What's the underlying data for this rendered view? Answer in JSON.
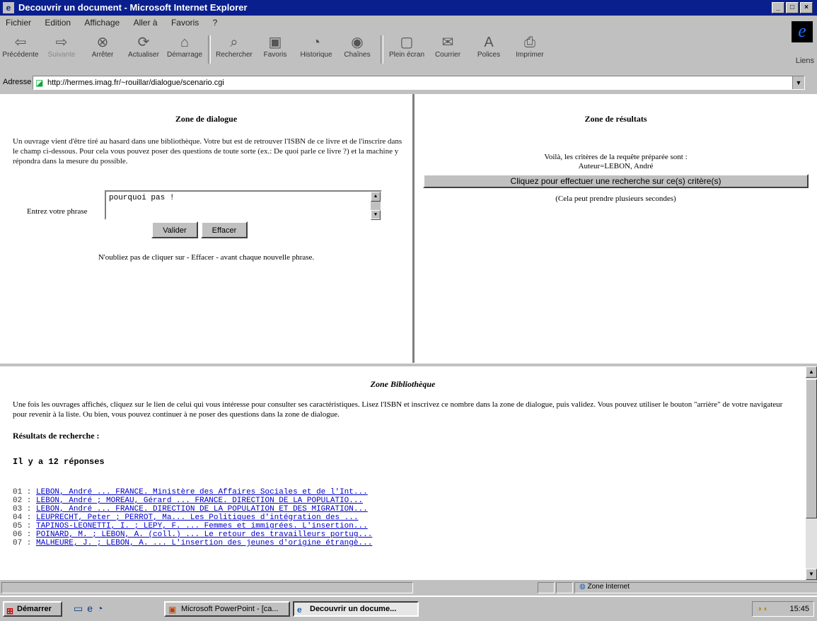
{
  "window": {
    "title": "Decouvrir un document - Microsoft Internet Explorer",
    "controls": [
      "_",
      "□",
      "×"
    ]
  },
  "menu": [
    "Fichier",
    "Edition",
    "Affichage",
    "Aller à",
    "Favoris",
    "?"
  ],
  "toolbar": [
    {
      "label": "Précédente",
      "icon": "back-arrow-icon",
      "glyph": "⇦"
    },
    {
      "label": "Suivante",
      "icon": "forward-arrow-icon",
      "glyph": "⇨"
    },
    {
      "label": "Arrêter",
      "icon": "stop-icon",
      "glyph": "⊗"
    },
    {
      "label": "Actualiser",
      "icon": "refresh-icon",
      "glyph": "⟳"
    },
    {
      "label": "Démarrage",
      "icon": "home-icon",
      "glyph": "⌂"
    },
    {
      "label": "Rechercher",
      "icon": "search-icon",
      "glyph": "⌕"
    },
    {
      "label": "Favoris",
      "icon": "favorites-icon",
      "glyph": "▣"
    },
    {
      "label": "Historique",
      "icon": "history-icon",
      "glyph": "◔"
    },
    {
      "label": "Chaînes",
      "icon": "channels-icon",
      "glyph": "◉"
    },
    {
      "label": "Plein écran",
      "icon": "fullscreen-icon",
      "glyph": "▢"
    },
    {
      "label": "Courrier",
      "icon": "mail-icon",
      "glyph": "✉"
    },
    {
      "label": "Polices",
      "icon": "fonts-icon",
      "glyph": "A"
    },
    {
      "label": "Imprimer",
      "icon": "print-icon",
      "glyph": "⎙"
    }
  ],
  "liens_label": "Liens",
  "address": {
    "label": "Adresse",
    "url": "http://hermes.imag.fr/~rouillar/dialogue/scenario.cgi"
  },
  "dialog_zone": {
    "title": "Zone de dialogue",
    "intro": "Un ouvrage vient d'être tiré au hasard dans une bibliothèque. Votre but est de retrouver l'ISBN de ce livre et de l'inscrire dans le champ ci-dessous. Pour cela vous pouvez poser des questions de toute sorte (ex.: De quoi parle ce livre ?) et la machine y répondra dans la mesure du possible.",
    "phrase_label": "Entrez votre phrase",
    "phrase_value": "pourquoi pas !",
    "validate_label": "Valider",
    "clear_label": "Effacer",
    "note": "N'oubliez pas de cliquer sur - Effacer - avant chaque nouvelle phrase."
  },
  "result_zone": {
    "title": "Zone de résultats",
    "line1": "Voilà, les critères de la requête préparée sont :",
    "line2": "Auteur=LEBON, André",
    "search_button": "Cliquez pour effectuer une recherche sur ce(s) critère(s)",
    "note": "(Cela peut prendre plusieurs secondes)"
  },
  "library_zone": {
    "title": "Zone Bibliothèque",
    "intro": "Une fois les ouvrages affichés, cliquez sur le lien de celui qui vous intéresse pour consulter ses caractéristiques. Lisez l'ISBN et inscrivez ce nombre dans la zone de dialogue, puis validez. Vous pouvez utiliser le bouton \"arrière\" de votre navigateur pour revenir à la liste. Ou bien, vous pouvez continuer à ne poser des questions dans la zone de dialogue.",
    "results_heading": "Résultats de recherche :",
    "count": "Il y a 12 réponses",
    "results": [
      {
        "num": "01 :",
        "text": "LEBON, André ... FRANCE. Ministère des Affaires Sociales et de l'Int..."
      },
      {
        "num": "02 :",
        "text": "LEBON, André ; MOREAU, Gérard ... FRANCE. DIRECTION DE LA POPULATIO..."
      },
      {
        "num": "03 :",
        "text": "LEBON, André ... FRANCE. DIRECTION DE LA POPULATION ET DES MIGRATION..."
      },
      {
        "num": "04 :",
        "text": "LEUPRECHT, Peter ; PERROT, Ma... Les Politiques d'intégration des ..."
      },
      {
        "num": "05 :",
        "text": "TAPINOS-LEONETTI, I. ; LEPY, F. ... Femmes et immigrées. L'insertion..."
      },
      {
        "num": "06 :",
        "text": "POINARD, M. ; LEBON, A. (coll.) ... Le retour des travailleurs portug..."
      },
      {
        "num": "07 :",
        "text": "MALHEURE, J. ; LEBON, A. ... L'insertion des jeunes d'origine étrangè..."
      }
    ]
  },
  "statusbar": {
    "zone": "Zone Internet"
  },
  "taskbar": {
    "start": "Démarrer",
    "tasks": [
      {
        "label": "Microsoft PowerPoint - [ca...",
        "icon": "powerpoint-icon",
        "active": false
      },
      {
        "label": "Decouvrir un docume...",
        "icon": "ie-page-icon",
        "active": true
      }
    ],
    "clock": "15:45"
  }
}
